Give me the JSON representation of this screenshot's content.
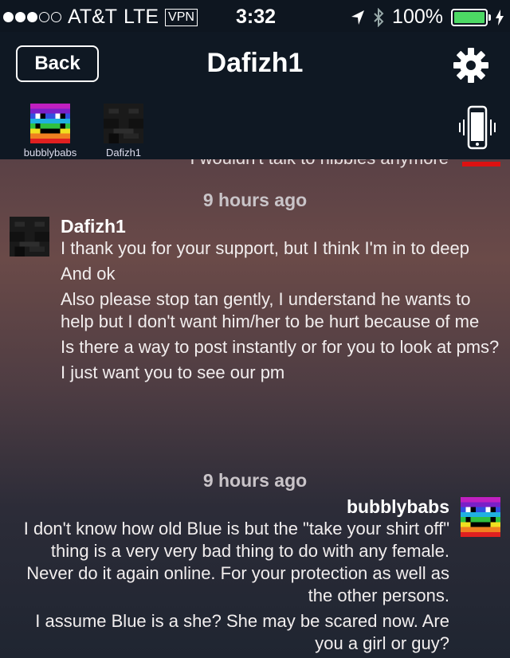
{
  "status_bar": {
    "carrier": "AT&T",
    "network": "LTE",
    "vpn": "VPN",
    "time": "3:32",
    "battery": "100%",
    "signal_bars_filled": 3,
    "signal_bars_total": 5
  },
  "nav": {
    "back_label": "Back",
    "title": "Dafizh1"
  },
  "participants": [
    {
      "name": "bubblybabs",
      "avatar": "rainbow-pixel-avatar"
    },
    {
      "name": "Dafizh1",
      "avatar": "dark-pixel-avatar"
    }
  ],
  "chat": {
    "clipped_previous_text": "I wouldn't talk to nibbles anymore",
    "groups": [
      {
        "timestamp": "9 hours ago",
        "sender": "Dafizh1",
        "side": "left",
        "lines": [
          "I thank you for your support, but I think I'm in to deep",
          "And ok",
          "Also please stop tan gently, I understand he wants to help but I don't want him/her to be hurt because of me",
          "Is there a way to post instantly or for you to look at pms?",
          "I just want you to see our pm"
        ]
      },
      {
        "timestamp": "9 hours ago",
        "sender": "bubblybabs",
        "side": "right",
        "lines": [
          "I don't know how old Blue is but the \"take your shirt off\" thing is a very very bad thing to do with any female.  Never do it again online.  For your protection as well as the other persons.",
          "I assume Blue is a she?  She may be scared now. Are you a girl or guy?"
        ]
      }
    ]
  },
  "colors": {
    "battery_green": "#4cd964",
    "nav_bg": "#0f1823",
    "accent_red": "#dd1111"
  }
}
